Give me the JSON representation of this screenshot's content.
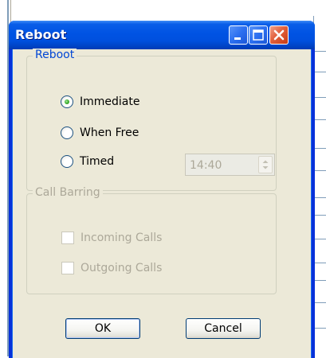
{
  "dialog": {
    "title": "Reboot"
  },
  "reboot_group": {
    "legend": "Reboot",
    "options": [
      {
        "label": "Immediate",
        "selected": true
      },
      {
        "label": "When Free",
        "selected": false
      },
      {
        "label": "Timed",
        "selected": false
      }
    ],
    "timed_value": "14:40"
  },
  "barring_group": {
    "legend": "Call Barring",
    "options": [
      {
        "label": "Incoming Calls",
        "checked": false
      },
      {
        "label": "Outgoing Calls",
        "checked": false
      }
    ]
  },
  "buttons": {
    "ok": "OK",
    "cancel": "Cancel"
  },
  "colors": {
    "title_bar": "#0053e3",
    "dialog_face": "#ece9d8",
    "group_legend": "#0046d5",
    "disabled_text": "#aca899",
    "radio_selected": "#3eaf2e"
  }
}
